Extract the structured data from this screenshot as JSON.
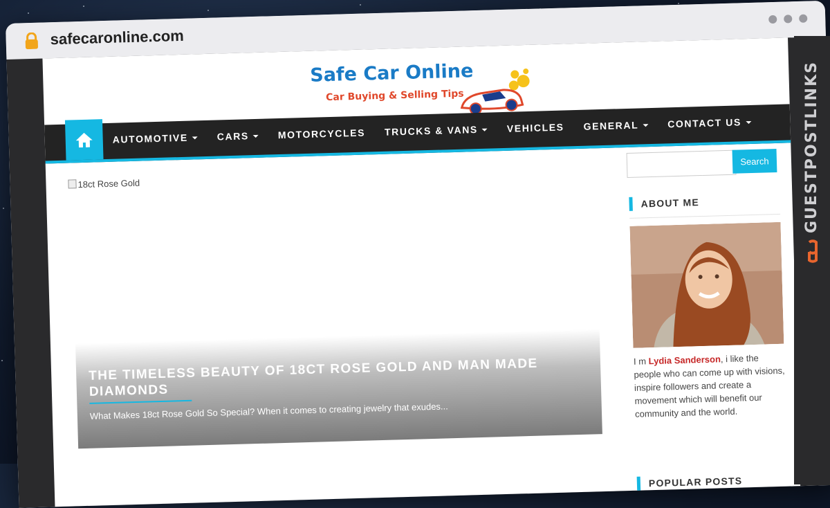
{
  "browser": {
    "url": "safecaronline.com"
  },
  "watermark": {
    "text": "GUESTPOSTLINKS"
  },
  "logo": {
    "title": "Safe Car Online",
    "tagline": "Car Buying & Selling Tips"
  },
  "nav": {
    "items": [
      {
        "label": "AUTOMOTIVE",
        "dropdown": true
      },
      {
        "label": "CARS",
        "dropdown": true
      },
      {
        "label": "MOTORCYCLES",
        "dropdown": false
      },
      {
        "label": "TRUCKS & VANS",
        "dropdown": true
      },
      {
        "label": "VEHICLES",
        "dropdown": false
      },
      {
        "label": "GENERAL",
        "dropdown": true
      },
      {
        "label": "CONTACT US",
        "dropdown": true
      }
    ]
  },
  "main": {
    "broken_image_alt": "18ct Rose Gold",
    "feature": {
      "title": "THE TIMELESS BEAUTY OF 18CT ROSE GOLD AND MAN MADE DIAMONDS",
      "excerpt": "What Makes 18ct Rose Gold So Special? When it comes to creating jewelry that exudes..."
    }
  },
  "sidebar": {
    "search": {
      "placeholder": "",
      "button_label": "Search"
    },
    "about": {
      "title": "ABOUT ME",
      "prefix": "I m ",
      "name": "Lydia Sanderson",
      "text": ", i like the people who can come up with visions, inspire followers and create a movement which will benefit our community and the world."
    },
    "popular": {
      "title": "POPULAR POSTS"
    }
  },
  "colors": {
    "accent": "#15b8e2",
    "nav_bg": "#232323",
    "name_red": "#c62828"
  }
}
